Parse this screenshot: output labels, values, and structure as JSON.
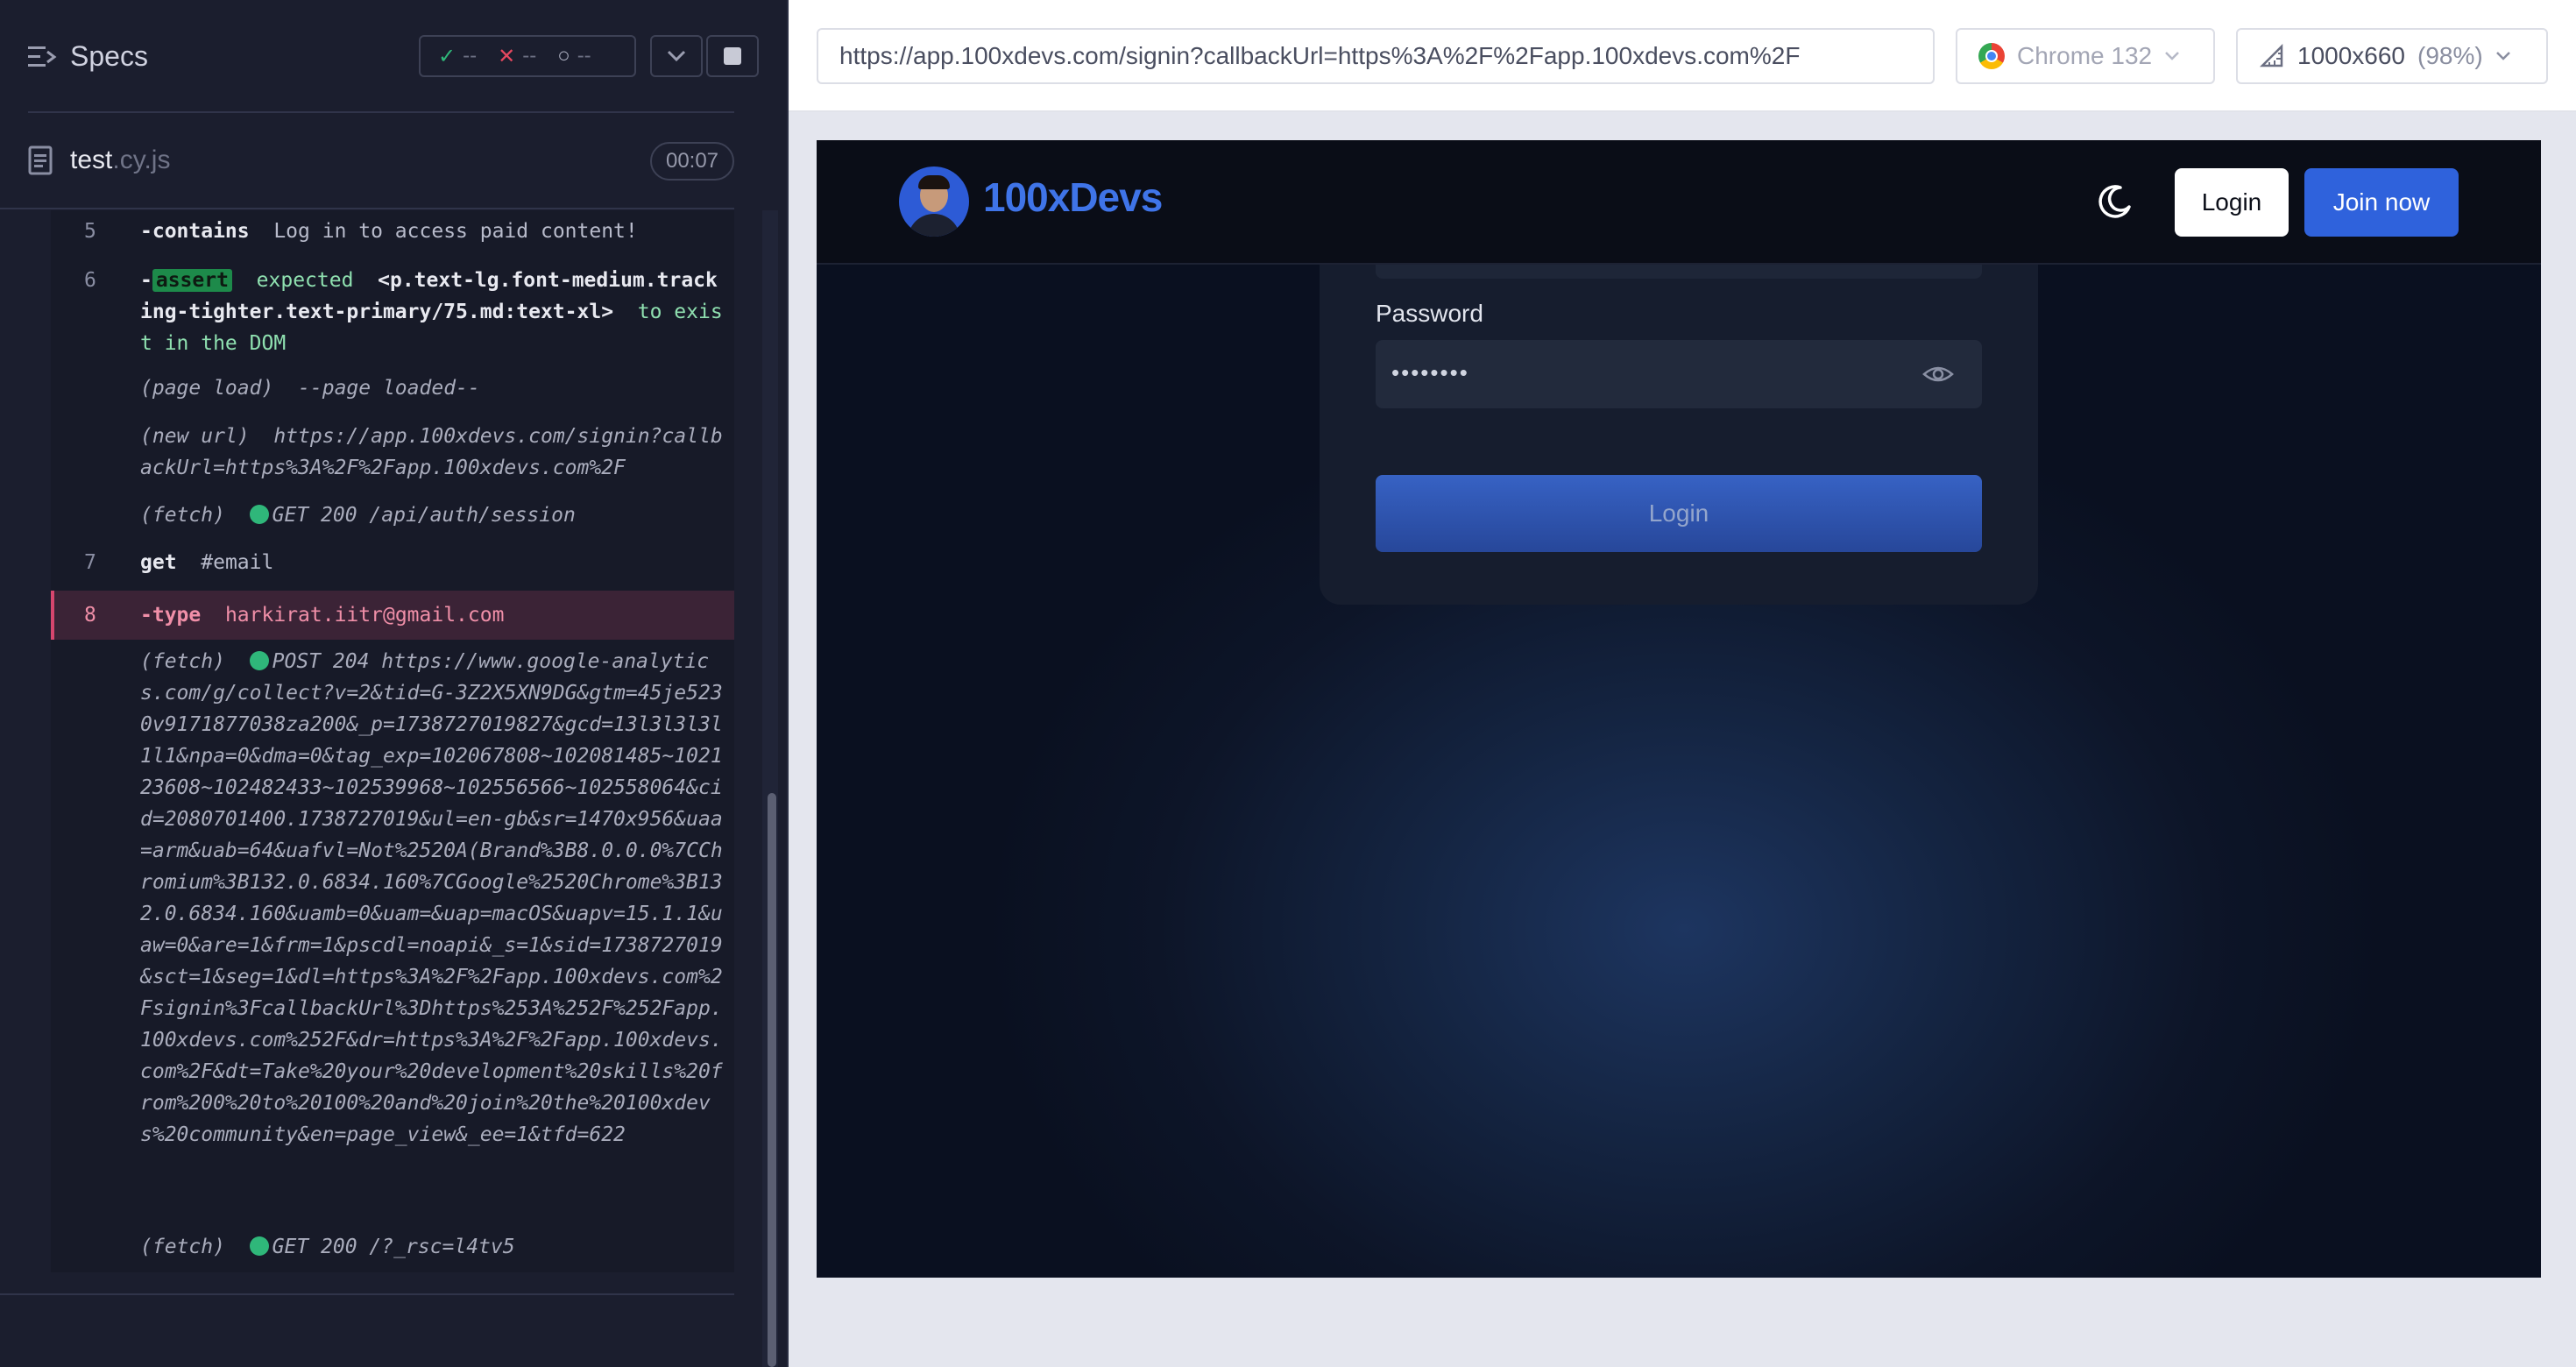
{
  "specs": {
    "title": "Specs",
    "passed": "--",
    "failed": "--",
    "pending": "--"
  },
  "file": {
    "base": "test",
    "ext": ".cy.js",
    "timer": "00:07"
  },
  "log": {
    "l5_num": "5",
    "l5_cmd": "-contains",
    "l5_arg": "Log in to access paid content!",
    "l6_num": "6",
    "l6_dash": "-",
    "l6_badge": "assert",
    "l6_text1": "expected",
    "l6_text2": "<p.text-lg.font-medium.tracking-tighter.text-primary/75.md:text-xl>",
    "l6_text3": "to exist in the DOM",
    "e1_label": "(page load)",
    "e1_text": "--page loaded--",
    "e2_label": "(new url)",
    "e2_text": "https://app.100xdevs.com/signin?callbackUrl=https%3A%2F%2Fapp.100xdevs.com%2F",
    "e3_label": "(fetch)",
    "e3_text": "GET 200 /api/auth/session",
    "l7_num": "7",
    "l7_cmd": "get",
    "l7_arg": "#email",
    "l8_num": "8",
    "l8_cmd": "-type",
    "l8_arg": "harkirat.iitr@gmail.com",
    "e4_label": "(fetch)",
    "e4_text": "POST 204 https://www.google-analytics.com/g/collect?v=2&tid=G-3Z2X5XN9DG&gtm=45je5230v9171877038za200&_p=1738727019827&gcd=13l3l3l3l1l1&npa=0&dma=0&tag_exp=102067808~102081485~102123608~102482433~102539968~102556566~102558064&cid=2080701400.1738727019&ul=en-gb&sr=1470x956&uaa=arm&uab=64&uafvl=Not%2520A(Brand%3B8.0.0.0%7CChromium%3B132.0.6834.160%7CGoogle%2520Chrome%3B132.0.6834.160&uamb=0&uam=&uap=macOS&uapv=15.1.1&uaw=0&are=1&frm=1&pscdl=noapi&_s=1&sid=1738727019&sct=1&seg=1&dl=https%3A%2F%2Fapp.100xdevs.com%2Fsignin%3FcallbackUrl%3Dhttps%253A%252F%252Fapp.100xdevs.com%252F&dr=https%3A%2F%2Fapp.100xdevs.com%2F&dt=Take%20your%20development%20skills%20from%200%20to%20100%20and%20join%20the%20100xdevs%20community&en=page_view&_ee=1&tfd=622",
    "e5_label": "(fetch)",
    "e5_text": "GET 200 /?_rsc=l4tv5"
  },
  "toolbar": {
    "url": "https://app.100xdevs.com/signin?callbackUrl=https%3A%2F%2Fapp.100xdevs.com%2F",
    "browser": "Chrome 132",
    "viewport": "1000x660",
    "zoom": "(98%)"
  },
  "app": {
    "brand": "100xDevs",
    "nav_login": "Login",
    "nav_join": "Join now",
    "password_label": "Password",
    "password_value": "••••••••",
    "login_button": "Login"
  },
  "colors": {
    "pass": "#2fb77a",
    "fail": "#e5485f",
    "accent": "#2f62dc"
  }
}
